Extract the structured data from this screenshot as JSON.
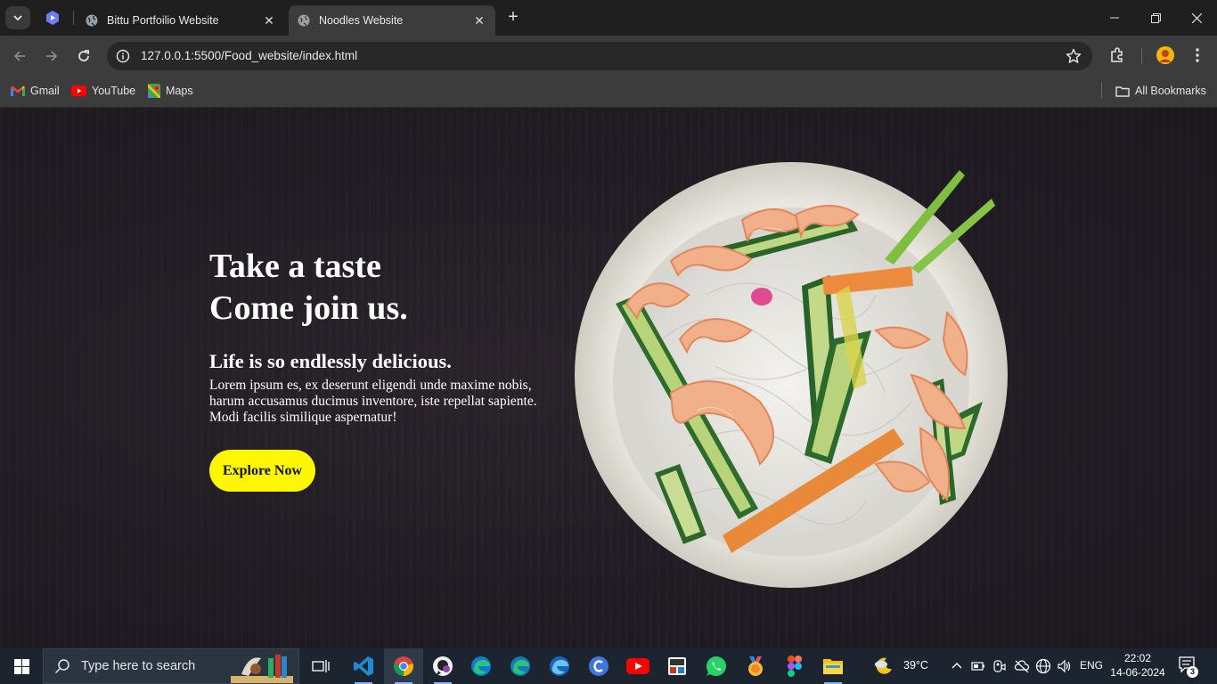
{
  "browser": {
    "tabs": [
      {
        "title": "Bittu Portfoilio Website",
        "active": false
      },
      {
        "title": "Noodles Website",
        "active": true
      }
    ],
    "url": "127.0.0.1:5500/Food_website/index.html",
    "bookmarks": [
      {
        "label": "Gmail",
        "icon": "gmail-icon"
      },
      {
        "label": "YouTube",
        "icon": "youtube-icon"
      },
      {
        "label": "Maps",
        "icon": "maps-icon"
      }
    ],
    "all_bookmarks_label": "All Bookmarks"
  },
  "hero": {
    "title_line1": "Take a taste",
    "title_line2": "Come join us.",
    "subtitle": "Life is so endlessly delicious.",
    "paragraph": "Lorem ipsum es, ex deserunt eligendi unde maxime nobis, harum accusamus ducimus inventore, iste repellat sapiente. Modi facilis similique aspernatur!",
    "cta_label": "Explore Now",
    "cta_color": "#fff700"
  },
  "taskbar": {
    "search_placeholder": "Type here to search",
    "weather": "39°C",
    "language": "ENG",
    "time": "22:02",
    "date": "14-06-2024",
    "notification_count": "3"
  }
}
